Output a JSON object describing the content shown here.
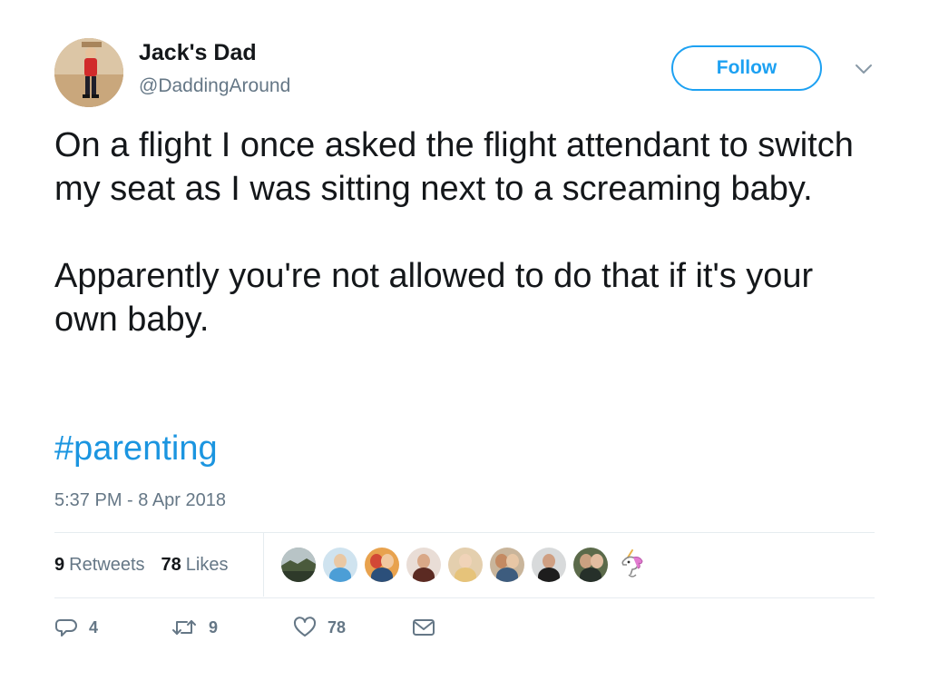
{
  "tweet": {
    "author": {
      "display_name": "Jack's Dad",
      "handle": "@DaddingAround"
    },
    "follow_label": "Follow",
    "text": [
      "On a flight I once asked the flight attendant to switch my seat as I was sitting next to a screaming baby.",
      "Apparently you're not allowed to do that if it's your own baby."
    ],
    "hashtag": "#parenting",
    "timestamp": "5:37 PM - 8 Apr 2018",
    "stats": {
      "retweets_count": "9",
      "retweets_label": "Retweets",
      "likes_count": "78",
      "likes_label": "Likes"
    },
    "actions": {
      "replies": "4",
      "retweets": "9",
      "likes": "78"
    }
  },
  "colors": {
    "accent": "#1da1f2",
    "hashtag": "#1b95e0",
    "secondary_text": "#657786",
    "divider": "#e6ecf0"
  },
  "icons": [
    "caret-down-icon",
    "reply-icon",
    "retweet-icon",
    "heart-icon",
    "mail-icon",
    "unicorn-icon"
  ]
}
